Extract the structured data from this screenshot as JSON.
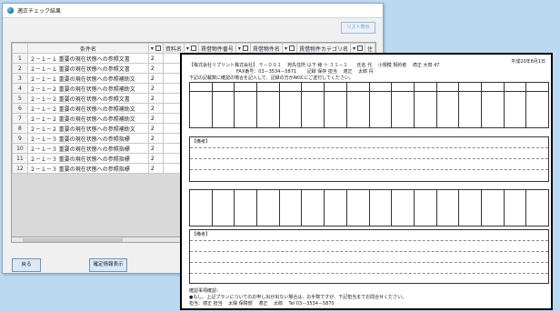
{
  "window": {
    "title": "適正チェック結果"
  },
  "top_button": "リスト表示",
  "grid": {
    "headers": [
      "",
      "条件名",
      "",
      "資料名",
      "",
      "賃借物件番号",
      "",
      "賃借物件名",
      "",
      "賃借物件カテゴリ名",
      "",
      "住"
    ],
    "rows": [
      {
        "n": "1",
        "name": "２－１－１ 重要の現在状態への参照文書",
        "v1": "2"
      },
      {
        "n": "2",
        "name": "２－１－１ 重要の現在状態への参照文書",
        "v1": "2"
      },
      {
        "n": "3",
        "name": "２－１－１ 重要の現在状態への参照補助文",
        "v1": "2"
      },
      {
        "n": "4",
        "name": "２－１－２ 重要の現在状態への参照補助文",
        "v1": "2"
      },
      {
        "n": "5",
        "name": "２－１－２ 重要の現在状態への参照文書",
        "v1": "2"
      },
      {
        "n": "6",
        "name": "２－１－２ 重要の現在状態への参照補助文",
        "v1": "2"
      },
      {
        "n": "7",
        "name": "２－１－２ 重要の現在状態への参照補助文",
        "v1": "2"
      },
      {
        "n": "8",
        "name": "２－１－２ 重要の現在状態への参照補助文",
        "v1": "2"
      },
      {
        "n": "9",
        "name": "２－１－３ 重要の現在状態への参照指標",
        "v1": "2"
      },
      {
        "n": "10",
        "name": "２－１－３ 重要の現在状態への参照指標",
        "v1": "2"
      },
      {
        "n": "11",
        "name": "２－１－３ 重要の現在状態への参照指標",
        "v1": "2"
      },
      {
        "n": "12",
        "name": "２－１－３ 重要の現在状態への参照指標",
        "v1": "2"
      }
    ]
  },
  "buttons": {
    "back": "戻る",
    "confirm": "確定情報表示"
  },
  "paper": {
    "header_right": "平成20年8月1日",
    "line1": "【株式会社リプリント株式会社】 〒－００１　 宛先住所 以下 様 ト ３１－１　　氏名 代　 小規模 契約者　 適正 大田 47",
    "line2": "FAX番号：03－3534－5871　　 記録 保存 担当　 適正　 太郎 丹",
    "line3": "下記の記載数に確認の場合を記入して、記録の方がAKICにご送付してください。",
    "section_note": "【備考】",
    "footer1": "確認事項確認：",
    "footer2": "●もし、上記プランについてのお申し出が出ない場合は、お手数ですが、下記担当までお問合せください。",
    "footer3": "担当：適正 担当　 太陽 保険部　 適正　 太郎　 Tel 03－3534－5870"
  }
}
